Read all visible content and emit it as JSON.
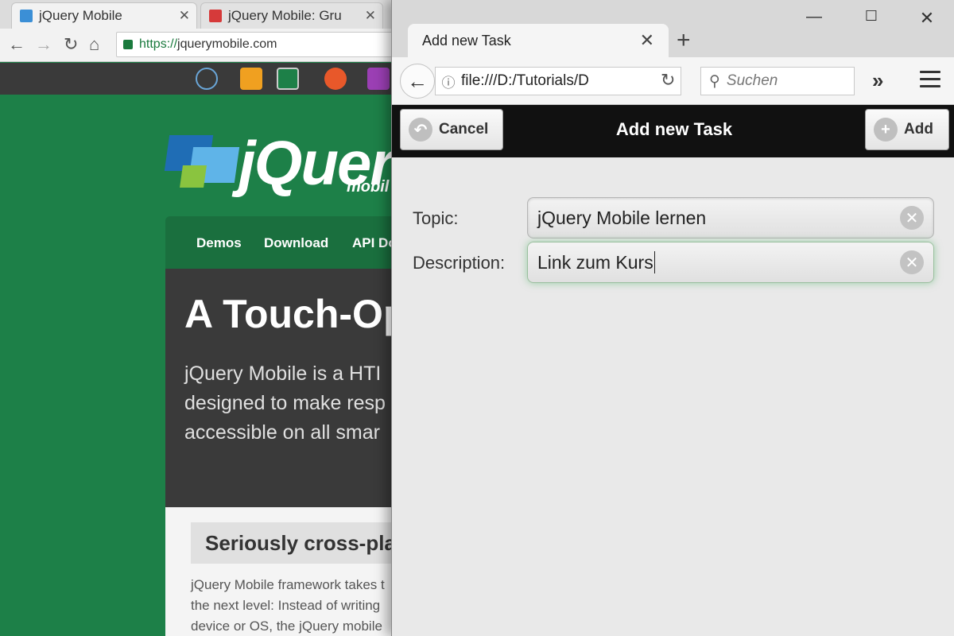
{
  "chrome": {
    "tabs": [
      {
        "title": "jQuery Mobile",
        "active": true
      },
      {
        "title": "jQuery Mobile: Gru",
        "active": false
      }
    ],
    "url_scheme": "https://",
    "url_host": "jquerymobile.com"
  },
  "site": {
    "logo_word": "jQuer",
    "logo_sub": "mobil",
    "nav": [
      "Demos",
      "Download",
      "API Do"
    ],
    "hero_title": "A Touch-Op",
    "hero_lines": [
      "jQuery Mobile is a HTI",
      "designed to make resp",
      "accessible on all smar"
    ],
    "section_title": "Seriously cross-plat",
    "content_lines": [
      "jQuery Mobile framework takes t",
      "the next level: Instead of writing",
      "device or OS, the jQuery mobile"
    ]
  },
  "firefox": {
    "tab_title": "Add new Task",
    "url": "file:///D:/Tutorials/D",
    "search_placeholder": "Suchen"
  },
  "jqm": {
    "header_title": "Add new Task",
    "cancel_label": "Cancel",
    "add_label": "Add",
    "fields": [
      {
        "label": "Topic:",
        "value": "jQuery Mobile lernen"
      },
      {
        "label": "Description:",
        "value": "Link zum Kurs"
      }
    ]
  },
  "colors": {
    "site_green": "#1d8048",
    "jqm_header": "#111111",
    "focus_glow": "#5ab46e"
  }
}
